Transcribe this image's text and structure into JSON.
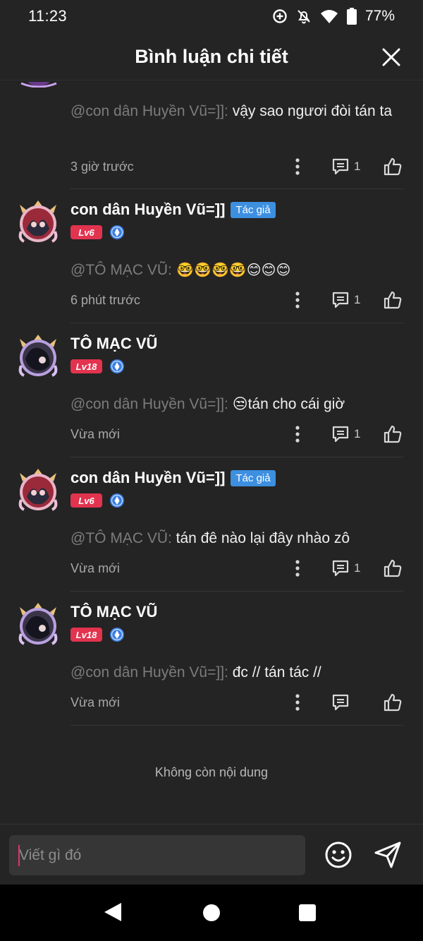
{
  "status_bar": {
    "time": "11:23",
    "battery": "77%",
    "icons": [
      "data-saver-icon",
      "notifications-off-icon",
      "wifi-icon",
      "battery-icon"
    ]
  },
  "header": {
    "title": "Bình luận chi tiết",
    "close_icon": "close-icon"
  },
  "comments": [
    {
      "mention": "@con dân Huyền Vũ=]]:",
      "text": " vậy sao ngươi đòi tán ta",
      "time": "3 giờ trước",
      "reply_count": "1"
    },
    {
      "username": "con dân Huyền Vũ=]]",
      "author_badge": "Tác giả",
      "level": "Lv6",
      "mention": "@TÔ MẠC VŨ:",
      "text": " 🤓🤓🤓🤓😊😊😊",
      "time": "6 phút trước",
      "reply_count": "1"
    },
    {
      "username": "TÔ MẠC VŨ",
      "level": "Lv18",
      "mention": "@con dân Huyền Vũ=]]:",
      "text": " 😒tán cho cái giờ",
      "time": "Vừa mới",
      "reply_count": "1"
    },
    {
      "username": "con dân Huyền Vũ=]]",
      "author_badge": "Tác giả",
      "level": "Lv6",
      "mention": "@TÔ MẠC VŨ:",
      "text": " tán đê nào lại đây nhào zô",
      "time": "Vừa mới",
      "reply_count": "1"
    },
    {
      "username": "TÔ MẠC VŨ",
      "level": "Lv18",
      "mention": "@con dân Huyền Vũ=]]:",
      "text": " đc // tán tác //",
      "time": "Vừa mới",
      "reply_count": ""
    }
  ],
  "end_text": "Không còn nội dung",
  "input": {
    "placeholder": "Viết gì đó"
  },
  "colors": {
    "background": "#242424",
    "author_badge": "#3d8fe0",
    "level_badge": "#e2334f",
    "verify_badge": "#3b7fe0",
    "mention": "#7c7c7c"
  }
}
